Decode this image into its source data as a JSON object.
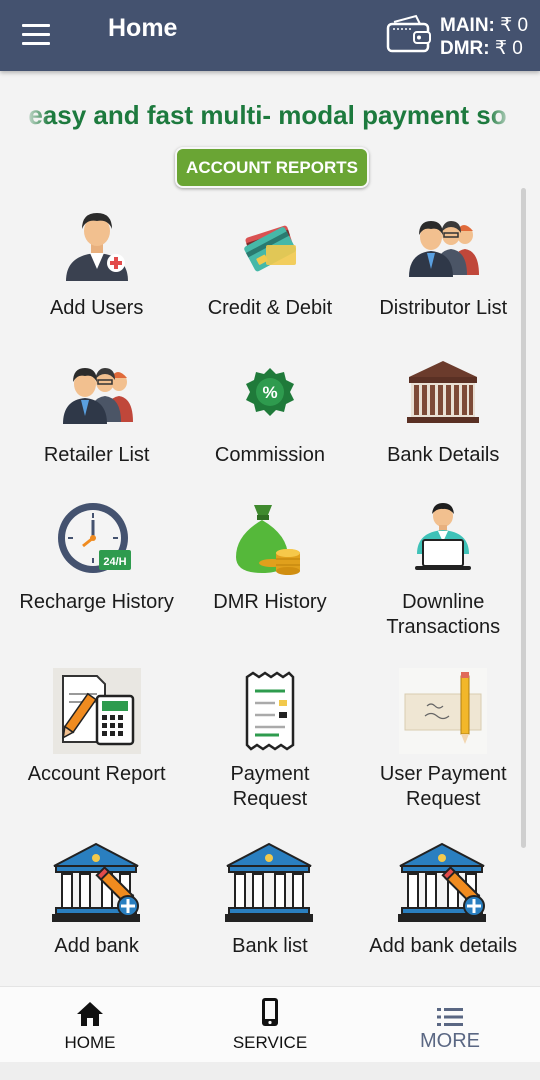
{
  "header": {
    "title": "Home",
    "icon": "wallet-icon",
    "main_label": "MAIN:",
    "main_value": "₹ 0",
    "dmr_label": "DMR:",
    "dmr_value": "₹ 0"
  },
  "marquee": {
    "text": "fe easy and fast multi- modal payment so"
  },
  "account_reports_label": "ACCOUNT REPORTS",
  "menu": {
    "rows": [
      [
        {
          "label": "Add Users",
          "icon": "add-user-icon"
        },
        {
          "label": "Credit & Debit",
          "icon": "credit-card-icon"
        },
        {
          "label": "Distributor List",
          "icon": "distributor-group-icon"
        }
      ],
      [
        {
          "label": "Retailer List",
          "icon": "retailer-group-icon"
        },
        {
          "label": "Commission",
          "icon": "percent-badge-icon"
        },
        {
          "label": "Bank Details",
          "icon": "bank-building-icon"
        }
      ],
      [
        {
          "label": "Recharge History",
          "icon": "clock-24h-icon"
        },
        {
          "label": "DMR History",
          "icon": "money-bag-icon"
        },
        {
          "label": "Downline\nTransactions",
          "icon": "user-laptop-icon"
        }
      ],
      [
        {
          "label": "Account Report",
          "icon": "calculator-report-icon"
        },
        {
          "label": "Payment\nRequest",
          "icon": "receipt-icon"
        },
        {
          "label": "User Payment\nRequest",
          "icon": "cheque-pencil-icon"
        }
      ],
      [
        {
          "label": "Add bank",
          "icon": "bank-add-icon"
        },
        {
          "label": "Bank list",
          "icon": "bank-icon"
        },
        {
          "label": "Add bank details",
          "icon": "bank-add-icon"
        }
      ]
    ]
  },
  "bottom_nav": [
    {
      "label": "HOME",
      "icon": "home-icon"
    },
    {
      "label": "SERVICE",
      "icon": "mobile-icon"
    },
    {
      "label": "MORE",
      "icon": "list-icon"
    }
  ],
  "colors": {
    "header_bg": "#44526f",
    "marquee_text": "#1d7a3e",
    "account_button": "#6aa534",
    "more_active": "#5a6783"
  }
}
